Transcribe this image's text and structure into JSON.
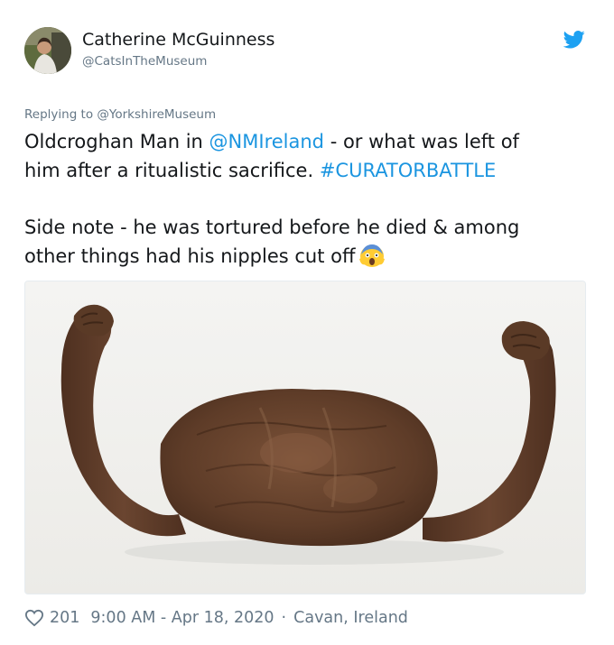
{
  "author": {
    "display_name": "Catherine McGuinness",
    "handle": "@CatsInTheMuseum"
  },
  "icons": {
    "logo": "twitter-bird-icon",
    "like": "heart-icon",
    "emoji": "scream-emoji-icon"
  },
  "colors": {
    "link": "#1b95e0",
    "muted": "#657786",
    "text": "#14171a"
  },
  "reply": {
    "label": "Replying to @YorkshireMuseum"
  },
  "tweet": {
    "line1_pre": "Oldcroghan Man in ",
    "line1_mention": "@NMIreland",
    "line1_post": " - or what was left of",
    "line2_pre": "him after a ritualistic sacrifice. ",
    "line2_hashtag": "#CURATORBATTLE",
    "line3": "Side note - he was tortured before he died & among",
    "line4": "other things had his nipples cut off"
  },
  "footer": {
    "likes": "201",
    "time": "9:00 AM - Apr 18, 2020",
    "separator": "·",
    "location": "Cavan, Ireland"
  }
}
